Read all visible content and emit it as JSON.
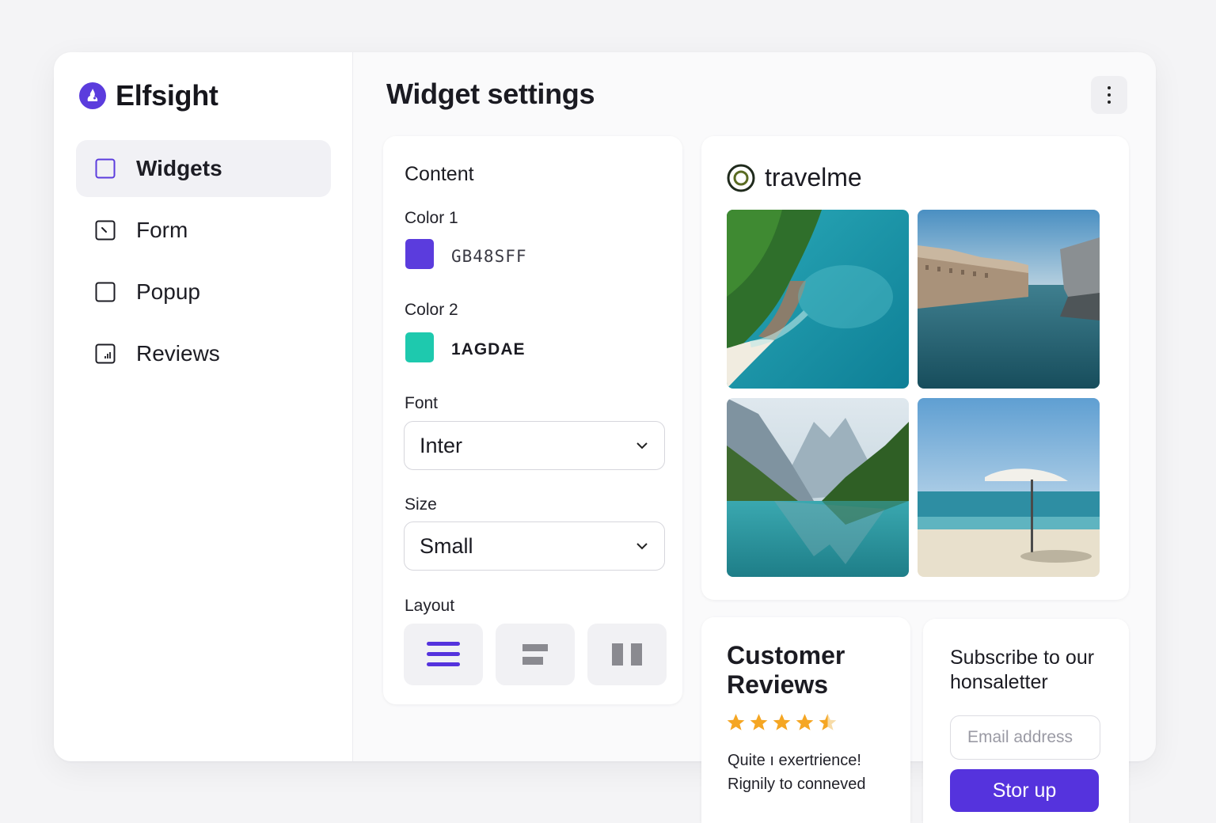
{
  "brand": {
    "name": "Elfsight"
  },
  "sidebar": {
    "items": [
      {
        "label": "Widgets",
        "icon": "square-icon",
        "active": true
      },
      {
        "label": "Form",
        "icon": "form-icon",
        "active": false
      },
      {
        "label": "Popup",
        "icon": "popup-icon",
        "active": false
      },
      {
        "label": "Reviews",
        "icon": "reviews-icon",
        "active": false
      }
    ]
  },
  "header": {
    "title": "Widget settings",
    "menu_icon": "more-vertical-icon"
  },
  "settings": {
    "section_title": "Content",
    "color1": {
      "label": "Color 1",
      "value": "GB48SFF",
      "swatch": "#5b3cdd"
    },
    "color2": {
      "label": "Color 2",
      "value": "1AGDAE",
      "swatch": "#1ec9ae"
    },
    "font": {
      "label": "Font",
      "value": "Inter"
    },
    "size": {
      "label": "Size",
      "value": "Small"
    },
    "layout": {
      "label": "Layout",
      "options": [
        {
          "icon": "layout-list-icon",
          "selected": true
        },
        {
          "icon": "layout-stack-icon",
          "selected": false
        },
        {
          "icon": "layout-columns-icon",
          "selected": false
        }
      ]
    }
  },
  "feed": {
    "account": "travelme",
    "icon": "instagram-icon",
    "photos": [
      "tropical-coast-photo",
      "coastal-town-photo",
      "mountain-lake-photo",
      "beach-umbrella-photo"
    ]
  },
  "reviews": {
    "title": "Customer Reviews",
    "rating": 4.5,
    "text_line1": "Quite ı exertrience!",
    "text_line2": "Rignily to conneved"
  },
  "newsletter": {
    "title": "Subscribe to our honsaletter",
    "email_placeholder": "Email address",
    "button_label": "Stor up"
  },
  "colors": {
    "accent": "#5533dd",
    "teal": "#1ec9ae",
    "star": "#f5a623"
  }
}
